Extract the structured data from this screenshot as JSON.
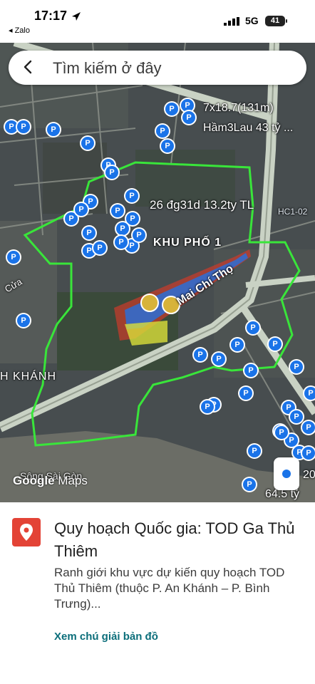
{
  "status_bar": {
    "time": "17:17",
    "back_app": "◂ Zalo",
    "network": "5G",
    "battery": "41"
  },
  "search": {
    "placeholder": "Tìm kiếm ở đây"
  },
  "map": {
    "labels": {
      "listing_1_line1": "7x18.7(131m)",
      "listing_1_line2": "Hầm3Lau 43 tỷ ...",
      "listing_2": "26 đg31d 13.2ty TL",
      "area": "KHU PHỐ 1",
      "road_code": "HC1-02",
      "street": "Mai Chí Thọ",
      "left_fragment": "Cửa",
      "ward": "H KHÁNH",
      "river": "Sông Sài Gòn",
      "price_fragment_1": "20",
      "price_fragment_2": "64.5 tỷ"
    },
    "attribution": {
      "google": "Google",
      "maps": "Maps"
    },
    "colors": {
      "boundary": "#39e53a",
      "marker": "#1a73e8",
      "road": "#b9c7b4"
    }
  },
  "place": {
    "title": "Quy hoạch Quốc gia: TOD Ga Thủ Thiêm",
    "description": "Ranh giới khu vực dự kiến quy hoạch TOD Thủ Thiêm (thuộc P. An Khánh – P. Bình Trưng)...",
    "legend_link": "Xem chú giải bản đồ",
    "icon": "map-pin-icon"
  }
}
